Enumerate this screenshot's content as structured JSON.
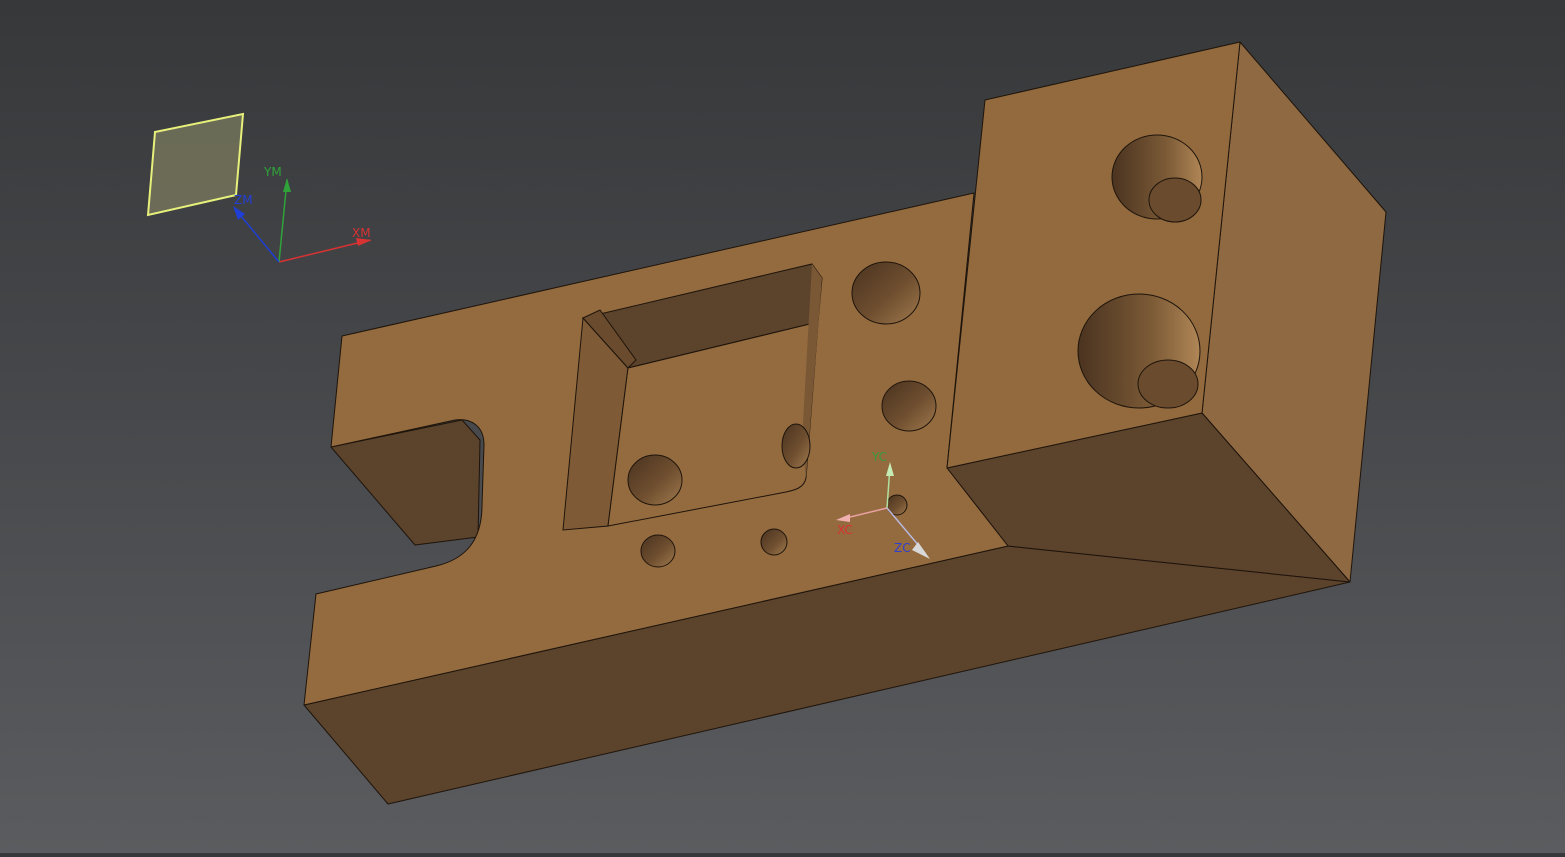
{
  "viewport": {
    "background_top": "#36383a",
    "background_bottom": "#5a5c5f"
  },
  "colors": {
    "part_top": "#946b3f",
    "part_side_dark": "#5c432c",
    "part_side_mid": "#8c6640",
    "hole_inner": "#5a3f26",
    "edge": "#1e140b",
    "wcs_plane": "#7a7a5a",
    "wcs_plane_edge": "#e6f07a",
    "x_axis": "#d93232",
    "y_axis": "#2fa33a",
    "z_axis": "#1f3fd6"
  },
  "absolute_csys": {
    "plane_icon": "datum-plane-icon",
    "x_label": "XM",
    "y_label": "YM",
    "z_label": "ZM"
  },
  "work_csys": {
    "x_label": "XC",
    "y_label": "YC",
    "z_label": "ZC"
  }
}
